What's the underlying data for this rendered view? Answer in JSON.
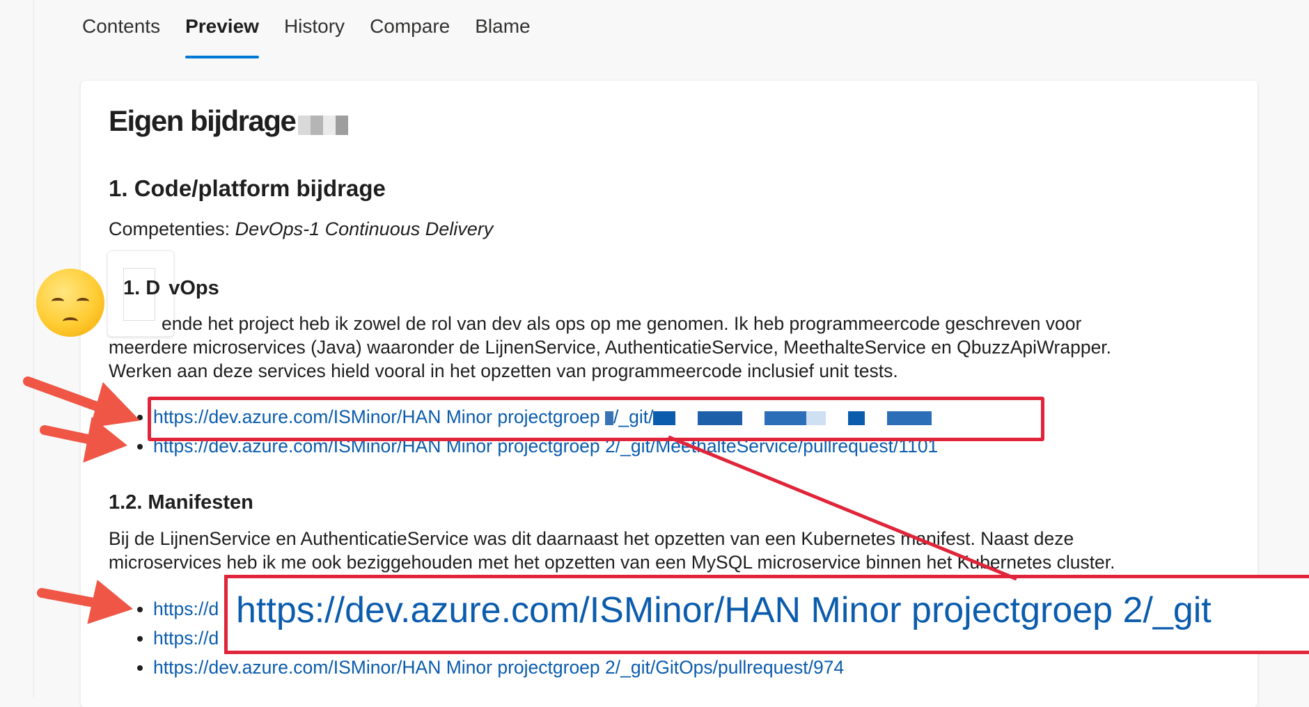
{
  "tabs": [
    "Contents",
    "Preview",
    "History",
    "Compare",
    "Blame"
  ],
  "active_tab": "Preview",
  "doc": {
    "title": "Eigen bijdrage",
    "section1": "1. Code/platform bijdrage",
    "competencies_label": "Competenties: ",
    "competencies_value": "DevOps-1 Continuous Delivery",
    "sub1_prefix": "1. D",
    "sub1_suffix": "vOps",
    "para1_line1": "ende het project heb ik zowel de rol van dev als ops op me genomen. Ik heb programmeercode geschreven voor",
    "para1_line2": "meerdere microservices (Java) waaronder de LijnenService, AuthenticatieService, MeethalteService en QbuzzApiWrapper.",
    "para1_line3": "Werken aan deze services hield vooral in het opzetten van programmeercode inclusief unit tests.",
    "link1": "https://dev.azure.com/ISMinor/HAN Minor projectgroep ",
    "link1_tail": "/_git/",
    "link2": "https://dev.azure.com/ISMinor/HAN Minor projectgroep 2/_git/MeethalteService/pullrequest/1101",
    "sub2": "1.2. Manifesten",
    "para2_line1": "Bij de LijnenService en AuthenticatieService was dit daarnaast het opzetten van een Kubernetes manifest. Naast deze",
    "para2_line2": "microservices heb ik me ook beziggehouden met het opzetten van een MySQL microservice binnen het Kubernetes cluster.",
    "link3": "https://d",
    "link4": "https://d",
    "link5": "https://dev.azure.com/ISMinor/HAN Minor projectgroep 2/_git/GitOps/pullrequest/974",
    "zoom_text": "https://dev.azure.com/ISMinor/HAN Minor projectgroep 2/_git"
  },
  "colors": {
    "accent": "#0078d4",
    "link": "#0b5cad",
    "annotation": "#e0253a",
    "arrow": "#ef5646"
  },
  "icons": [
    "pensive-face-emoji",
    "annotation-arrow"
  ]
}
